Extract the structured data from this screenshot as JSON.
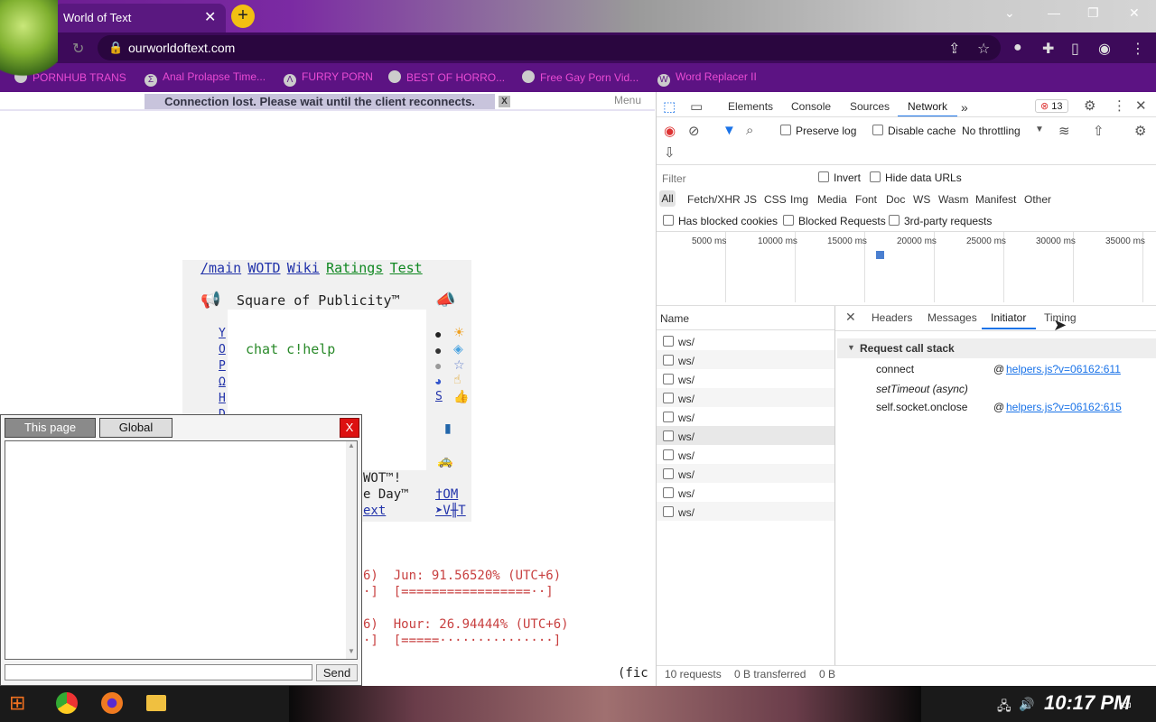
{
  "browser": {
    "tab_title": "World of Text",
    "tab_close": "✕",
    "new_tab": "+",
    "url": "ourworldoftext.com",
    "window_minimize": "—",
    "window_restore": "❐",
    "window_close": "✕",
    "bookmarks": [
      {
        "label": "PORNHUB TRANS"
      },
      {
        "label": "Anal Prolapse Time..."
      },
      {
        "label": "FURRY PORN"
      },
      {
        "label": "BEST OF HORRO..."
      },
      {
        "label": "Free Gay Porn Vid..."
      },
      {
        "label": "Word Replacer II"
      }
    ]
  },
  "page": {
    "connection_banner": "Connection lost. Please wait until the client reconnects.",
    "connection_close": "X",
    "menu_label": "Menu",
    "nav_links": [
      "/main",
      "WOTD",
      "Wiki",
      "Ratings",
      "Test"
    ],
    "publicity_title": "Square of Publicity™",
    "publicity_text": "chat c!help",
    "left_letters": [
      "Y",
      "O",
      "P",
      "Ω",
      "H",
      "D"
    ],
    "right_icon_s": "S",
    "wot_line1": "WOT™!",
    "wot_line2": "e Day™",
    "wot_line3": "ext",
    "wot_link1": "†OM",
    "wot_link2": "➤V╫T",
    "progress_line1": "6)  Jun: 91.56520% (UTC+6)",
    "progress_line2": "·]  [=================··]",
    "progress_line3": "6)  Hour: 26.94444% (UTC+6)",
    "progress_line4": "·]  [=====···············]",
    "bottom_text": "(fic"
  },
  "chat": {
    "tab_page": "This page",
    "tab_global": "Global",
    "close": "X",
    "send": "Send",
    "input_value": ""
  },
  "devtools": {
    "tabs": [
      "Elements",
      "Console",
      "Sources",
      "Network"
    ],
    "more_tabs": "»",
    "error_count": "13",
    "preserve_log": "Preserve log",
    "disable_cache": "Disable cache",
    "throttling": "No throttling",
    "filter_placeholder": "Filter",
    "invert": "Invert",
    "hide_data_urls": "Hide data URLs",
    "filter_types": [
      "All",
      "Fetch/XHR",
      "JS",
      "CSS",
      "Img",
      "Media",
      "Font",
      "Doc",
      "WS",
      "Wasm",
      "Manifest",
      "Other"
    ],
    "has_blocked_cookies": "Has blocked cookies",
    "blocked_requests": "Blocked Requests",
    "third_party": "3rd-party requests",
    "timeline_ticks": [
      "5000 ms",
      "10000 ms",
      "15000 ms",
      "20000 ms",
      "25000 ms",
      "30000 ms",
      "35000 ms"
    ],
    "name_header": "Name",
    "requests": [
      "ws/",
      "ws/",
      "ws/",
      "ws/",
      "ws/",
      "ws/",
      "ws/",
      "ws/",
      "ws/",
      "ws/"
    ],
    "detail_close": "✕",
    "detail_tabs": [
      "Headers",
      "Messages",
      "Initiator",
      "Timing"
    ],
    "call_stack_title": "Request call stack",
    "call_stack": [
      {
        "fn": "connect",
        "at": "@",
        "link": "helpers.js?v=06162:611"
      },
      {
        "fn": "setTimeout (async)",
        "at": "",
        "link": ""
      },
      {
        "fn": "self.socket.onclose",
        "at": "@",
        "link": "helpers.js?v=06162:615"
      }
    ],
    "status_requests": "10 requests",
    "status_transferred": "0 B transferred",
    "status_resources": "0 B"
  },
  "taskbar": {
    "clock": "10:17 PM"
  }
}
